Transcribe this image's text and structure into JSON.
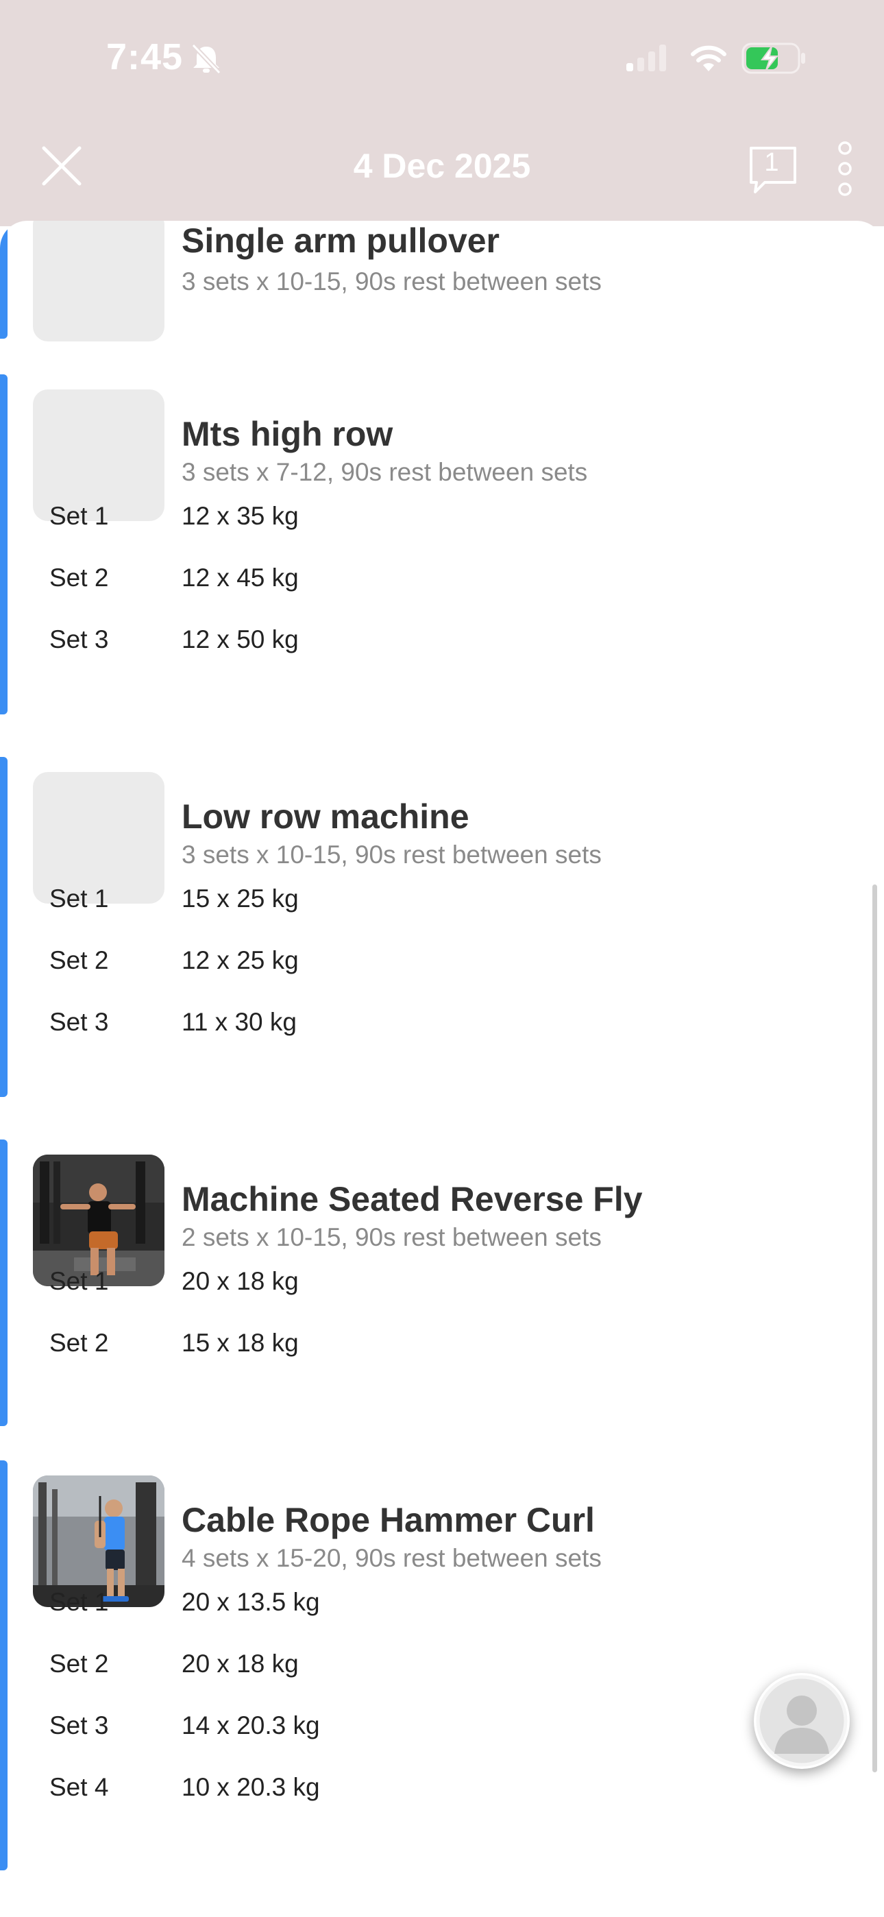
{
  "status_bar": {
    "time": "7:45"
  },
  "header": {
    "title": "4 Dec 2025",
    "chat_count": "1"
  },
  "exercises": [
    {
      "name": "Single arm pullover",
      "summary": "3 sets x 10-15, 90s rest between sets",
      "sets": []
    },
    {
      "name": "Mts high row",
      "summary": "3 sets x 7-12, 90s rest between sets",
      "sets": [
        {
          "label": "Set 1",
          "value": "12 x 35 kg"
        },
        {
          "label": "Set 2",
          "value": "12 x 45 kg"
        },
        {
          "label": "Set 3",
          "value": "12 x 50 kg"
        }
      ]
    },
    {
      "name": "Low row machine",
      "summary": "3 sets x 10-15, 90s rest between sets",
      "sets": [
        {
          "label": "Set 1",
          "value": "15 x 25 kg"
        },
        {
          "label": "Set 2",
          "value": "12 x 25 kg"
        },
        {
          "label": "Set 3",
          "value": "11 x 30 kg"
        }
      ]
    },
    {
      "name": "Machine Seated Reverse Fly",
      "summary": "2 sets x 10-15, 90s rest between sets",
      "sets": [
        {
          "label": "Set 1",
          "value": "20 x 18 kg"
        },
        {
          "label": "Set 2",
          "value": "15 x 18 kg"
        }
      ]
    },
    {
      "name": "Cable Rope Hammer Curl",
      "summary": "4 sets x 15-20, 90s rest between sets",
      "sets": [
        {
          "label": "Set 1",
          "value": "20 x 13.5 kg"
        },
        {
          "label": "Set 2",
          "value": "20 x 18 kg"
        },
        {
          "label": "Set 3",
          "value": "14 x 20.3 kg"
        },
        {
          "label": "Set 4",
          "value": "10 x 20.3 kg"
        }
      ]
    }
  ],
  "colors": {
    "accent": "#3b8ef3",
    "header_bg": "#e5dada",
    "battery": "#34c759"
  },
  "icons": [
    "bell-slash-icon",
    "signal-icon",
    "wifi-icon",
    "battery-icon",
    "close-icon",
    "chat-icon",
    "more-icon",
    "avatar-icon"
  ]
}
